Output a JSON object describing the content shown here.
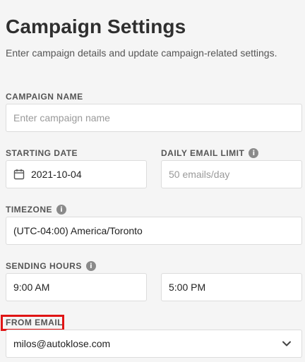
{
  "header": {
    "title": "Campaign Settings",
    "subtitle": "Enter campaign details and update campaign-related settings."
  },
  "form": {
    "campaign_name": {
      "label": "CAMPAIGN NAME",
      "placeholder": "Enter campaign name",
      "value": ""
    },
    "starting_date": {
      "label": "STARTING DATE",
      "value": "2021-10-04",
      "icon": "calendar-icon"
    },
    "daily_email_limit": {
      "label": "DAILY EMAIL LIMIT",
      "placeholder": "50 emails/day",
      "value": "",
      "icon": "info-icon"
    },
    "timezone": {
      "label": "TIMEZONE",
      "value": "(UTC-04:00) America/Toronto",
      "icon": "info-icon"
    },
    "sending_hours": {
      "label": "SENDING HOURS",
      "start": "9:00 AM",
      "end": "5:00 PM",
      "icon": "info-icon"
    },
    "from_email": {
      "label": "FROM EMAIL",
      "value": "milos@autoklose.com",
      "icon": "chevron-down-icon"
    }
  },
  "colors": {
    "background": "#f5f5f5",
    "highlight": "#e01515"
  }
}
